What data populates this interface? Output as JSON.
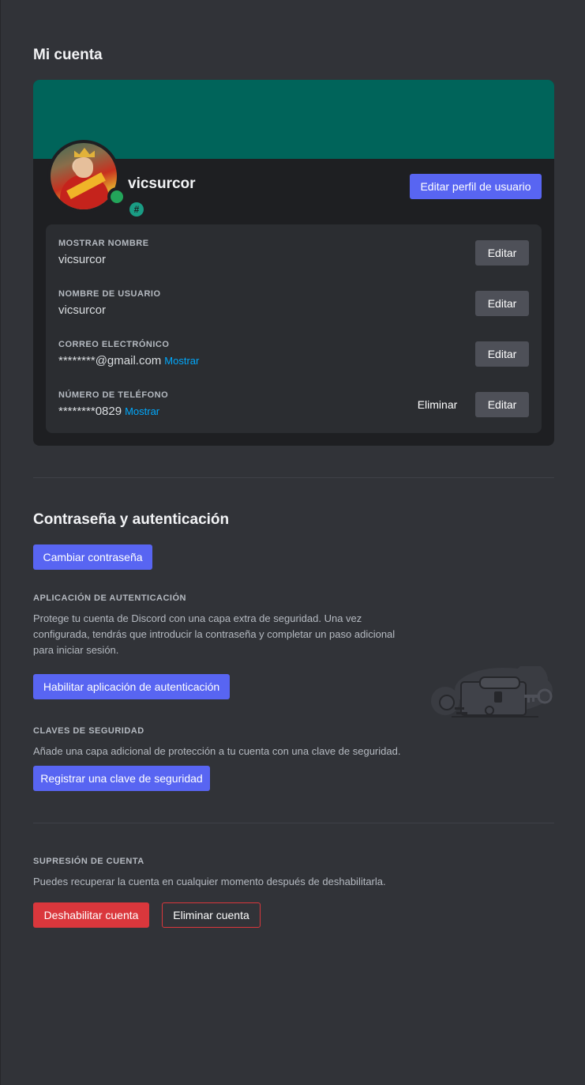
{
  "account": {
    "title": "Mi cuenta",
    "banner_color": "#00645a",
    "username": "vicsurcor",
    "badge_icon": "hashtag-badge-icon",
    "badge_glyph": "#",
    "status": "online",
    "edit_profile_label": "Editar perfil de usuario",
    "fields": [
      {
        "label": "MOSTRAR NOMBRE",
        "value": "vicsurcor",
        "edit_label": "Editar"
      },
      {
        "label": "NOMBRE DE USUARIO",
        "value": "vicsurcor",
        "edit_label": "Editar"
      },
      {
        "label": "CORREO ELECTRÓNICO",
        "value": "********@gmail.com",
        "reveal_label": "Mostrar",
        "edit_label": "Editar"
      },
      {
        "label": "NÚMERO DE TELÉFONO",
        "value": "********0829",
        "reveal_label": "Mostrar",
        "remove_label": "Eliminar",
        "edit_label": "Editar"
      }
    ]
  },
  "security": {
    "title": "Contraseña y autenticación",
    "change_password_label": "Cambiar contraseña",
    "auth_app": {
      "label": "APLICACIÓN DE AUTENTICACIÓN",
      "description_lines": [
        "Protege tu cuenta de Discord con una capa extra de seguridad. Una vez",
        "configurada, tendrás que introducir la contraseña y completar un paso adicional",
        "para iniciar sesión."
      ],
      "button_label": "Habilitar aplicación de autenticación"
    },
    "security_keys": {
      "label": "CLAVES DE SEGURIDAD",
      "description": "Añade una capa adicional de protección a tu cuenta con una clave de seguridad.",
      "button_label": "Registrar una clave de seguridad"
    }
  },
  "deletion": {
    "label": "SUPRESIÓN DE CUENTA",
    "description": "Puedes recuperar la cuenta en cualquier momento después de deshabilitarla.",
    "disable_label": "Deshabilitar cuenta",
    "delete_label": "Eliminar cuenta"
  },
  "colors": {
    "blurple": "#5865f2",
    "danger": "#da373c",
    "link": "#00a8fc",
    "online": "#23a55a",
    "background": "#313338"
  }
}
